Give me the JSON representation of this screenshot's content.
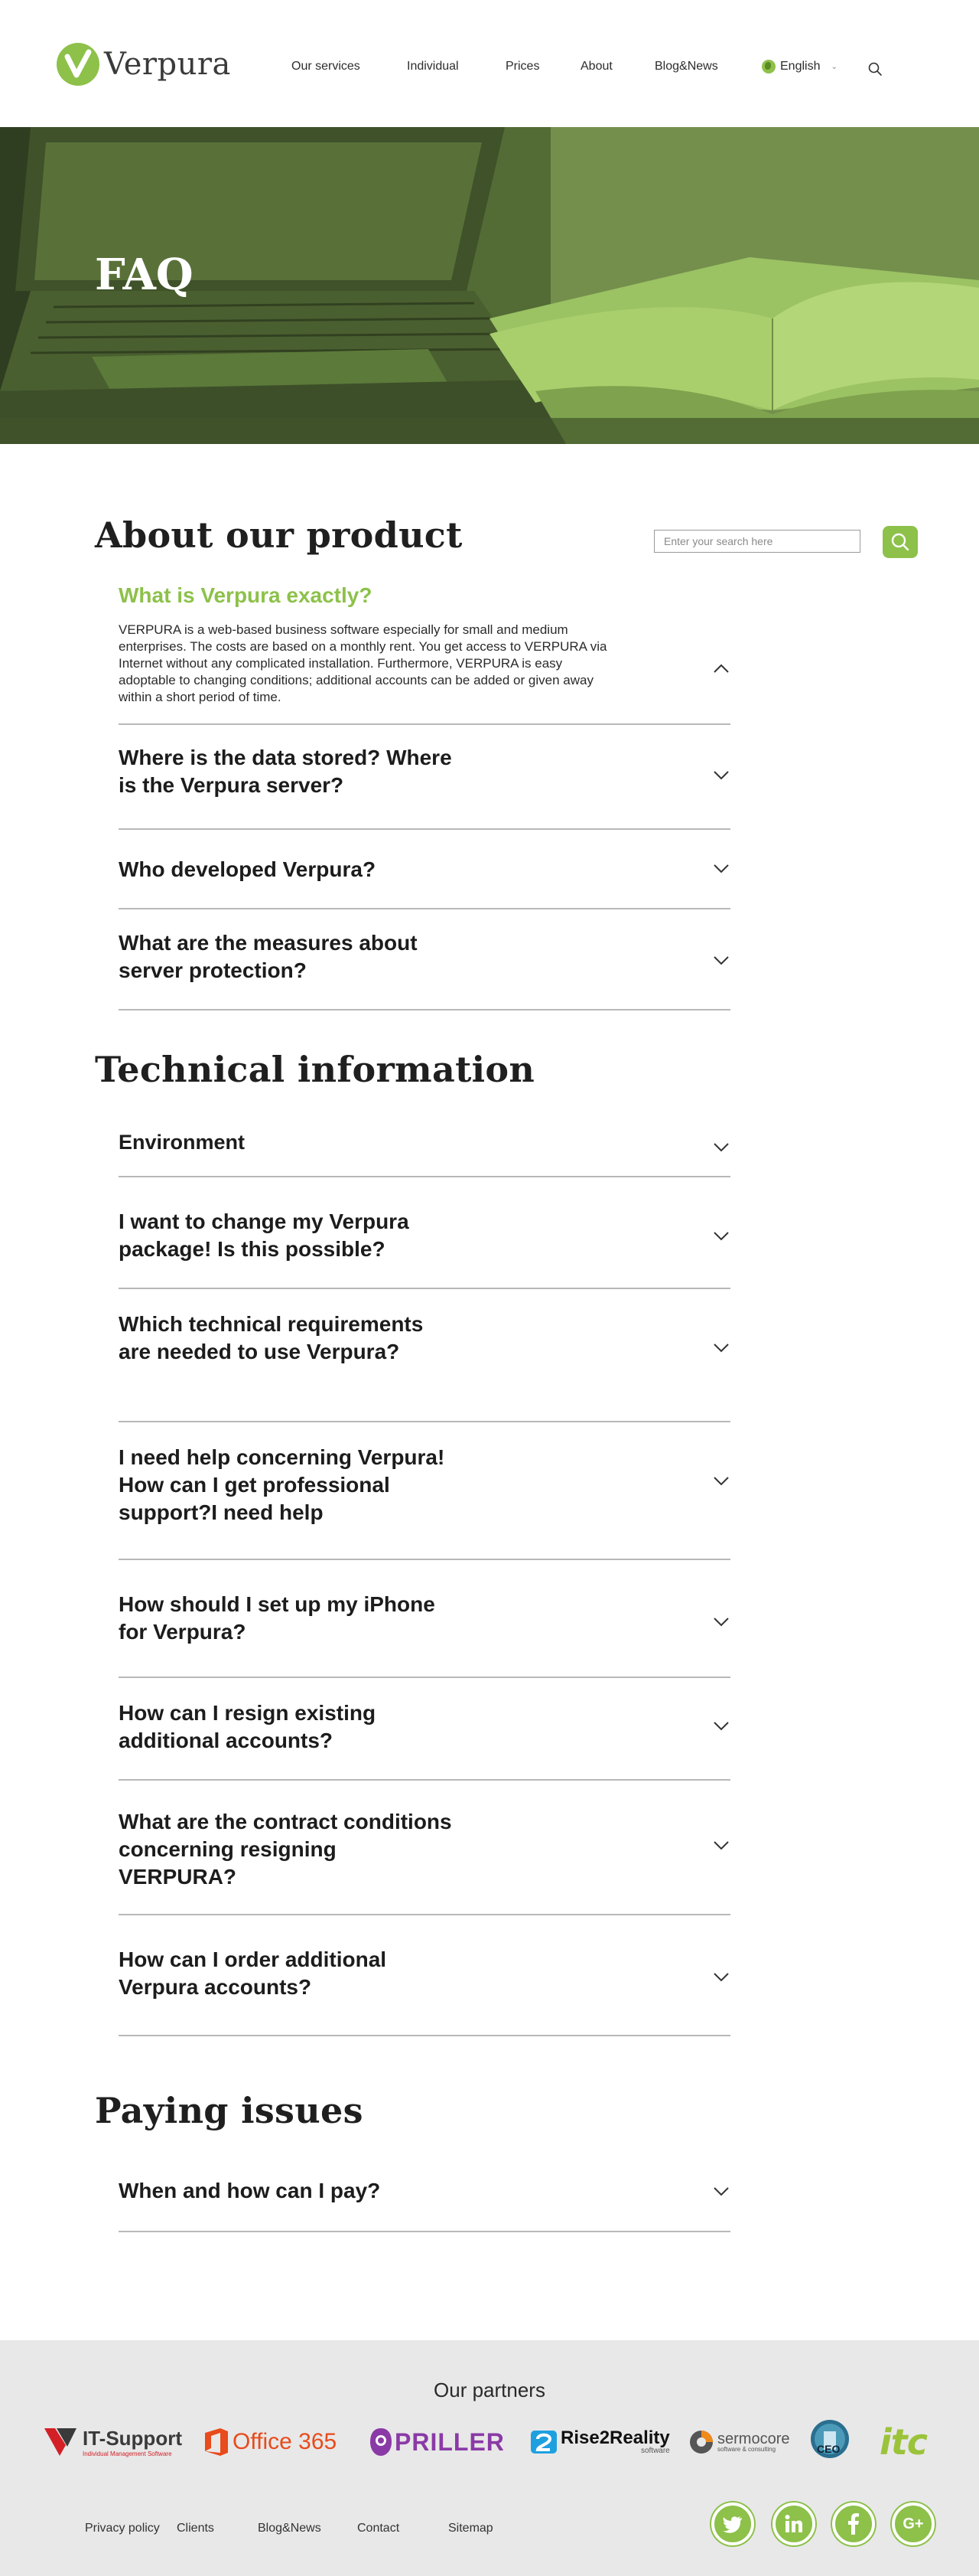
{
  "brand": {
    "name": "Verpura",
    "accent": "#8dc14a"
  },
  "nav": {
    "items": [
      "Our services",
      "Individual",
      "Prices",
      "About",
      "Blog&News"
    ],
    "language": "English"
  },
  "hero": {
    "title": "FAQ"
  },
  "search": {
    "placeholder": "Enter your search here"
  },
  "sections": {
    "product": {
      "title": "About our product",
      "open_question": "What is Verpura exactly?",
      "open_answer": "VERPURA is a web-based business software especially for small and medium enterprises. The costs are based on a monthly rent. You get access to VERPURA via Internet without any complicated installation. Furthermore, VERPURA is easy adoptable to changing conditions; additional accounts can be added or given away within a short period of time.",
      "questions": [
        "Where is the data stored? Where is the Verpura server?",
        "Who developed Verpura?",
        "What are the measures about server protection?"
      ]
    },
    "technical": {
      "title": "Technical information",
      "questions": [
        "Environment",
        "I want to change my Verpura package! Is this possible?",
        "Which technical requirements are needed to use Verpura?",
        "I need help concerning Verpura! How can I get professional support?I need help",
        "How should I set up my iPhone for Verpura?",
        "How can I resign existing additional accounts?",
        "What are the contract conditions concerning resigning VERPURA?",
        "How can I order additional Verpura accounts?"
      ]
    },
    "paying": {
      "title": "Paying issues",
      "questions": [
        "When and how can I pay?"
      ]
    }
  },
  "footer": {
    "partners_title": "Our partners",
    "partners": [
      "IT-Support",
      "Office 365",
      "PRILLER",
      "Rise2Reality",
      "sermocore",
      "CEO",
      "itc"
    ],
    "partner_subtexts": {
      "itsupport": "Individual Management Software",
      "rise2reality": "software",
      "sermocore": "software & consulting"
    },
    "links": [
      "Privacy policy",
      "Clients",
      "Blog&News",
      "Contact",
      "Sitemap"
    ],
    "social": [
      "twitter",
      "linkedin",
      "facebook",
      "google-plus"
    ]
  }
}
